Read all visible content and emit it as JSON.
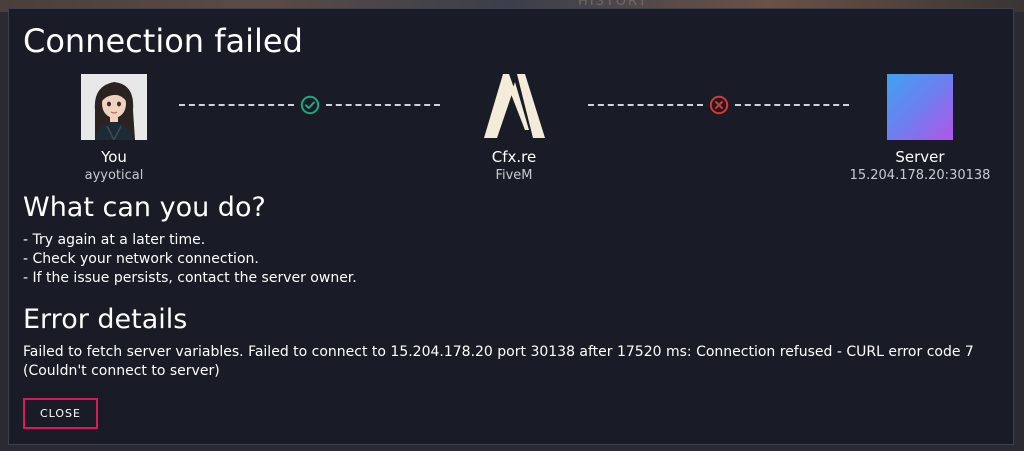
{
  "backdrop": {
    "label": "HISTORY"
  },
  "dialog": {
    "title": "Connection failed",
    "nodes": {
      "you": {
        "name": "You",
        "sub": "ayyotical",
        "icon": "user-avatar"
      },
      "cfx": {
        "name": "Cfx.re",
        "sub": "FiveM",
        "icon": "fivem-logo"
      },
      "server": {
        "name": "Server",
        "sub": "15.204.178.20:30138",
        "icon": "server-gradient-square"
      }
    },
    "links": [
      {
        "status": "success",
        "icon": "check-circle-icon",
        "color": "#1ea97c"
      },
      {
        "status": "failed",
        "icon": "x-circle-icon",
        "color": "#e0342f"
      }
    ],
    "help": {
      "heading": "What can you do?",
      "tips": [
        "- Try again at a later time.",
        "- Check your network connection.",
        "- If the issue persists, contact the server owner."
      ]
    },
    "error": {
      "heading": "Error details",
      "message": "Failed to fetch server variables. Failed to connect to 15.204.178.20 port 30138 after 17520 ms: Connection refused - CURL error code 7 (Couldn't connect to server)"
    },
    "close_label": "CLOSE",
    "accent_color": "#d81a5c"
  }
}
